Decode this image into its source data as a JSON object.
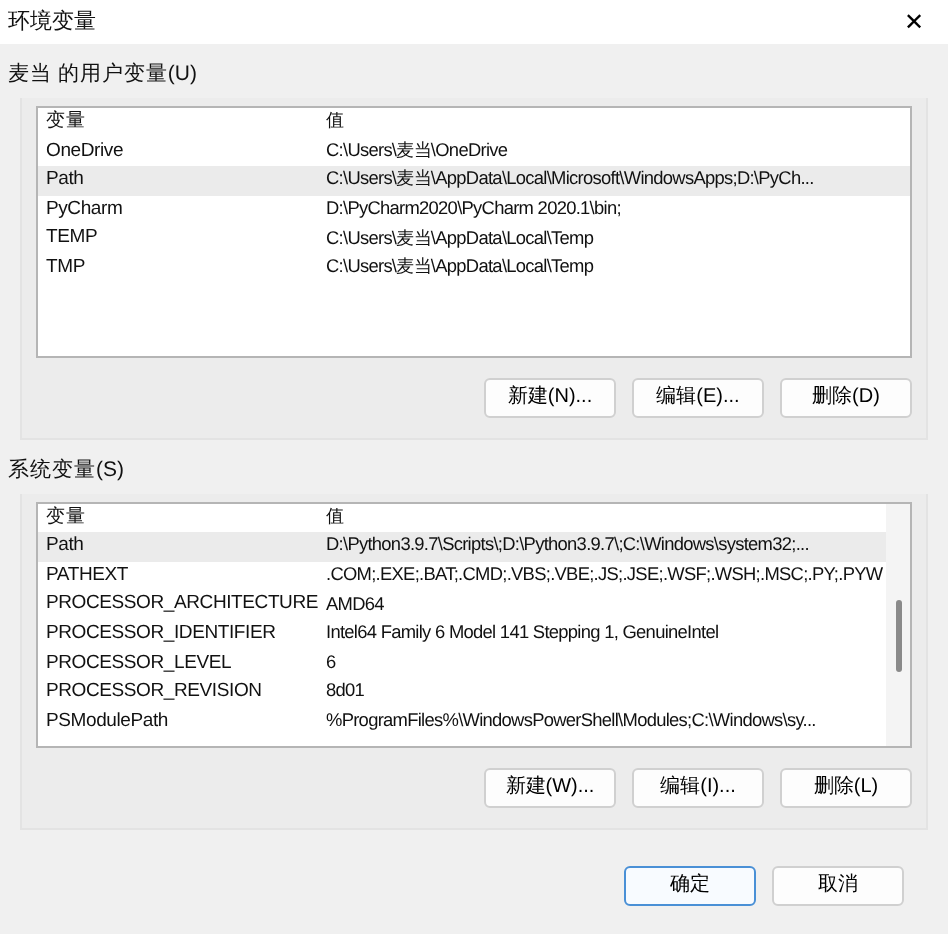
{
  "window": {
    "title": "环境变量",
    "close": "✕"
  },
  "user_vars": {
    "title": "麦当 的用户变量(U)",
    "columns": [
      "变量",
      "值"
    ],
    "rows": [
      {
        "name": "OneDrive",
        "value": "C:\\Users\\麦当\\OneDrive",
        "selected": false
      },
      {
        "name": "Path",
        "value": "C:\\Users\\麦当\\AppData\\Local\\Microsoft\\WindowsApps;D:\\PyCh...",
        "selected": true
      },
      {
        "name": "PyCharm",
        "value": "D:\\PyCharm2020\\PyCharm 2020.1\\bin;",
        "selected": false
      },
      {
        "name": "TEMP",
        "value": "C:\\Users\\麦当\\AppData\\Local\\Temp",
        "selected": false
      },
      {
        "name": "TMP",
        "value": "C:\\Users\\麦当\\AppData\\Local\\Temp",
        "selected": false
      }
    ],
    "buttons": [
      "新建(N)...",
      "编辑(E)...",
      "删除(D)"
    ]
  },
  "system_vars": {
    "title": "系统变量(S)",
    "columns": [
      "变量",
      "值"
    ],
    "rows": [
      {
        "name": "Path",
        "value": "D:\\Python3.9.7\\Scripts\\;D:\\Python3.9.7\\;C:\\Windows\\system32;...",
        "selected": true
      },
      {
        "name": "PATHEXT",
        "value": ".COM;.EXE;.BAT;.CMD;.VBS;.VBE;.JS;.JSE;.WSF;.WSH;.MSC;.PY;.PYW",
        "selected": false
      },
      {
        "name": "PROCESSOR_ARCHITECTURE",
        "value": "AMD64",
        "selected": false
      },
      {
        "name": "PROCESSOR_IDENTIFIER",
        "value": "Intel64 Family 6 Model 141 Stepping 1, GenuineIntel",
        "selected": false
      },
      {
        "name": "PROCESSOR_LEVEL",
        "value": "6",
        "selected": false
      },
      {
        "name": "PROCESSOR_REVISION",
        "value": "8d01",
        "selected": false
      },
      {
        "name": "PSModulePath",
        "value": "%ProgramFiles%\\WindowsPowerShell\\Modules;C:\\Windows\\sy...",
        "selected": false
      }
    ],
    "buttons": [
      "新建(W)...",
      "编辑(I)...",
      "删除(L)"
    ]
  },
  "footer_buttons": [
    {
      "label": "确定",
      "kind": "default"
    },
    {
      "label": "取消",
      "kind": "normal"
    }
  ]
}
